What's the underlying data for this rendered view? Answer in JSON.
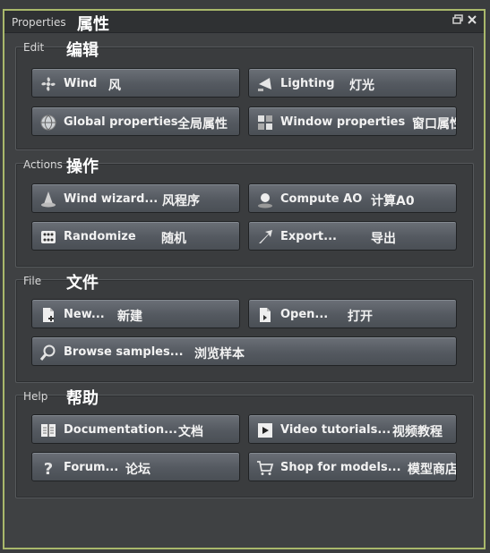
{
  "panel": {
    "title_en": "Properties",
    "title_cn": "属性"
  },
  "groups": {
    "edit": {
      "title_en": "Edit",
      "title_cn": "编辑"
    },
    "actions": {
      "title_en": "Actions",
      "title_cn": "操作"
    },
    "file": {
      "title_en": "File",
      "title_cn": "文件"
    },
    "help": {
      "title_en": "Help",
      "title_cn": "帮助"
    }
  },
  "buttons": {
    "wind": {
      "label": "Wind",
      "cn": "风",
      "icon": "fan-icon"
    },
    "lighting": {
      "label": "Lighting",
      "cn": "灯光",
      "icon": "spotlight-icon"
    },
    "global_properties": {
      "label": "Global properties",
      "cn": "全局属性",
      "icon": "globe-icon"
    },
    "window_properties": {
      "label": "Window properties",
      "cn": "窗口属性",
      "icon": "window-grid-icon"
    },
    "wind_wizard": {
      "label": "Wind wizard...",
      "cn": "风程序",
      "icon": "wizard-hat-icon"
    },
    "compute_ao": {
      "label": "Compute AO",
      "cn": "计算A0",
      "icon": "sphere-icon"
    },
    "randomize": {
      "label": "Randomize",
      "cn": "随机",
      "icon": "dice-icon"
    },
    "export": {
      "label": "Export...",
      "cn": "导出",
      "icon": "export-arrow-icon"
    },
    "new": {
      "label": "New...",
      "cn": "新建",
      "icon": "new-document-icon"
    },
    "open": {
      "label": "Open...",
      "cn": "打开",
      "icon": "open-document-icon"
    },
    "browse_samples": {
      "label": "Browse samples...",
      "cn": "浏览样本",
      "icon": "magnifier-icon"
    },
    "documentation": {
      "label": "Documentation...",
      "cn": "文档",
      "icon": "book-icon"
    },
    "video_tutorials": {
      "label": "Video tutorials...",
      "cn": "视频教程",
      "icon": "video-play-icon"
    },
    "forum": {
      "label": "Forum...",
      "cn": "论坛",
      "icon": "question-mark-icon"
    },
    "shop": {
      "label": "Shop for models...",
      "cn": "模型商店",
      "icon": "shopping-cart-icon"
    }
  },
  "colors": {
    "border_accent": "#a9b86b",
    "button_top": "#6b7077",
    "button_bottom": "#4a4f55"
  }
}
